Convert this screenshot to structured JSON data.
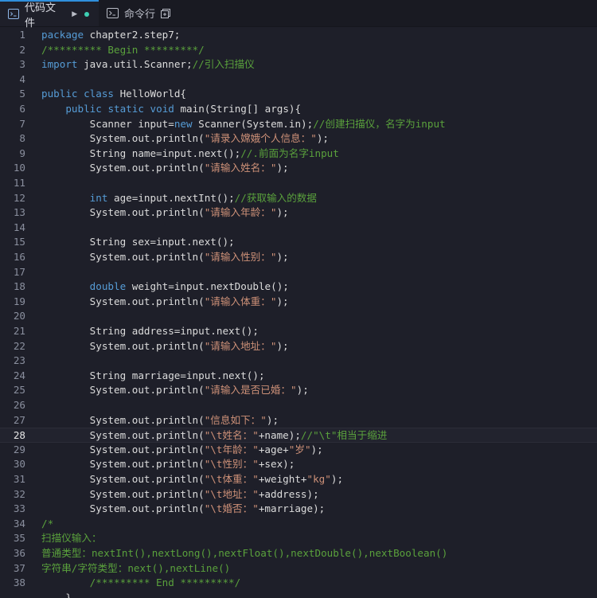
{
  "tabs": [
    {
      "label": "代码文件",
      "icon": "code-file-icon",
      "active": true
    },
    {
      "label": "命令行",
      "icon": "terminal-icon",
      "active": false
    }
  ],
  "colors": {
    "background": "#1e1f29",
    "keyword": "#569cd6",
    "comment": "#5aa13c",
    "string": "#ce9178",
    "text": "#dcdcdc",
    "active_tab_indicator": "#2f8fdd",
    "unsaved_dot": "#3ecfb3"
  },
  "editor": {
    "current_line": 28,
    "lines": [
      {
        "n": "1",
        "tokens": [
          [
            "kw",
            "package"
          ],
          [
            "pl",
            " chapter2.step7;"
          ]
        ]
      },
      {
        "n": "2",
        "tokens": [
          [
            "cm",
            "/********* Begin *********/"
          ]
        ]
      },
      {
        "n": "3",
        "tokens": [
          [
            "kw",
            "import"
          ],
          [
            "pl",
            " java.util.Scanner;"
          ],
          [
            "cm",
            "//引入扫描仪"
          ]
        ]
      },
      {
        "n": "4",
        "tokens": []
      },
      {
        "n": "5",
        "tokens": [
          [
            "kw",
            "public"
          ],
          [
            "pl",
            " "
          ],
          [
            "kw",
            "class"
          ],
          [
            "pl",
            " HelloWorld{"
          ]
        ]
      },
      {
        "n": "6",
        "tokens": [
          [
            "pl",
            "    "
          ],
          [
            "kw",
            "public"
          ],
          [
            "pl",
            " "
          ],
          [
            "kw",
            "static"
          ],
          [
            "pl",
            " "
          ],
          [
            "kw",
            "void"
          ],
          [
            "pl",
            " main(String[] args){"
          ]
        ]
      },
      {
        "n": "7",
        "tokens": [
          [
            "pl",
            "        Scanner input="
          ],
          [
            "kw",
            "new"
          ],
          [
            "pl",
            " Scanner(System.in);"
          ],
          [
            "cm",
            "//创建扫描仪，名字为input"
          ]
        ]
      },
      {
        "n": "8",
        "tokens": [
          [
            "pl",
            "        System.out.println("
          ],
          [
            "st",
            "\"请录入嫦娥个人信息：\""
          ],
          [
            "pl",
            ");"
          ]
        ]
      },
      {
        "n": "9",
        "tokens": [
          [
            "pl",
            "        String name=input.next();"
          ],
          [
            "cm",
            "//.前面为名字input"
          ]
        ]
      },
      {
        "n": "10",
        "tokens": [
          [
            "pl",
            "        System.out.println("
          ],
          [
            "st",
            "\"请输入姓名：\""
          ],
          [
            "pl",
            ");"
          ]
        ]
      },
      {
        "n": "11",
        "tokens": []
      },
      {
        "n": "12",
        "tokens": [
          [
            "pl",
            "        "
          ],
          [
            "kw",
            "int"
          ],
          [
            "pl",
            " age=input.nextInt();"
          ],
          [
            "cm",
            "//获取输入的数据"
          ]
        ]
      },
      {
        "n": "13",
        "tokens": [
          [
            "pl",
            "        System.out.println("
          ],
          [
            "st",
            "\"请输入年龄：\""
          ],
          [
            "pl",
            ");"
          ]
        ]
      },
      {
        "n": "14",
        "tokens": []
      },
      {
        "n": "15",
        "tokens": [
          [
            "pl",
            "        String sex=input.next();"
          ]
        ]
      },
      {
        "n": "16",
        "tokens": [
          [
            "pl",
            "        System.out.println("
          ],
          [
            "st",
            "\"请输入性别：\""
          ],
          [
            "pl",
            ");"
          ]
        ]
      },
      {
        "n": "17",
        "tokens": []
      },
      {
        "n": "18",
        "tokens": [
          [
            "pl",
            "        "
          ],
          [
            "kw",
            "double"
          ],
          [
            "pl",
            " weight=input.nextDouble();"
          ]
        ]
      },
      {
        "n": "19",
        "tokens": [
          [
            "pl",
            "        System.out.println("
          ],
          [
            "st",
            "\"请输入体重：\""
          ],
          [
            "pl",
            ");"
          ]
        ]
      },
      {
        "n": "20",
        "tokens": []
      },
      {
        "n": "21",
        "tokens": [
          [
            "pl",
            "        String address=input.next();"
          ]
        ]
      },
      {
        "n": "22",
        "tokens": [
          [
            "pl",
            "        System.out.println("
          ],
          [
            "st",
            "\"请输入地址：\""
          ],
          [
            "pl",
            ");"
          ]
        ]
      },
      {
        "n": "23",
        "tokens": []
      },
      {
        "n": "24",
        "tokens": [
          [
            "pl",
            "        String marriage=input.next();"
          ]
        ]
      },
      {
        "n": "25",
        "tokens": [
          [
            "pl",
            "        System.out.println("
          ],
          [
            "st",
            "\"请输入是否已婚：\""
          ],
          [
            "pl",
            ");"
          ]
        ]
      },
      {
        "n": "26",
        "tokens": []
      },
      {
        "n": "27",
        "tokens": [
          [
            "pl",
            "        System.out.println("
          ],
          [
            "st",
            "\"信息如下：\""
          ],
          [
            "pl",
            ");"
          ]
        ]
      },
      {
        "n": "28",
        "tokens": [
          [
            "pl",
            "        System.out.println("
          ],
          [
            "st",
            "\"\\t姓名：\""
          ],
          [
            "pl",
            "+name);"
          ],
          [
            "cm",
            "//\"\\t\"相当于缩进"
          ]
        ]
      },
      {
        "n": "29",
        "tokens": [
          [
            "pl",
            "        System.out.println("
          ],
          [
            "st",
            "\"\\t年龄：\""
          ],
          [
            "pl",
            "+age+"
          ],
          [
            "st",
            "\"岁\""
          ],
          [
            "pl",
            ");"
          ]
        ]
      },
      {
        "n": "30",
        "tokens": [
          [
            "pl",
            "        System.out.println("
          ],
          [
            "st",
            "\"\\t性别：\""
          ],
          [
            "pl",
            "+sex);"
          ]
        ]
      },
      {
        "n": "31",
        "tokens": [
          [
            "pl",
            "        System.out.println("
          ],
          [
            "st",
            "\"\\t体重：\""
          ],
          [
            "pl",
            "+weight+"
          ],
          [
            "st",
            "\"kg\""
          ],
          [
            "pl",
            ");"
          ]
        ]
      },
      {
        "n": "32",
        "tokens": [
          [
            "pl",
            "        System.out.println("
          ],
          [
            "st",
            "\"\\t地址：\""
          ],
          [
            "pl",
            "+address);"
          ]
        ]
      },
      {
        "n": "33",
        "tokens": [
          [
            "pl",
            "        System.out.println("
          ],
          [
            "st",
            "\"\\t婚否：\""
          ],
          [
            "pl",
            "+marriage);"
          ]
        ]
      },
      {
        "n": "34",
        "tokens": [
          [
            "cm",
            "/*"
          ]
        ]
      },
      {
        "n": "35",
        "tokens": [
          [
            "cm",
            "扫描仪输入："
          ]
        ]
      },
      {
        "n": "36",
        "tokens": [
          [
            "cm",
            "普通类型：nextInt(),nextLong(),nextFloat(),nextDouble(),nextBoolean()"
          ]
        ]
      },
      {
        "n": "37",
        "tokens": [
          [
            "cm",
            "字符串/字符类型：next(),nextLine()"
          ]
        ]
      },
      {
        "n": "38",
        "tokens": [
          [
            "cm",
            "        /********* End *********/"
          ]
        ]
      },
      {
        "n": "",
        "tokens": [
          [
            "pl",
            "    }"
          ]
        ]
      }
    ]
  }
}
